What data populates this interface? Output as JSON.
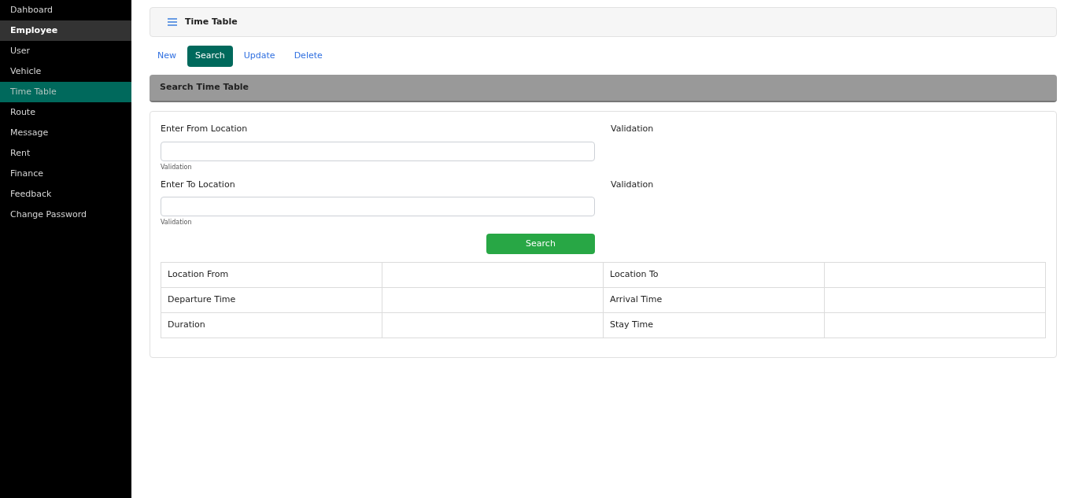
{
  "sidebar": {
    "items": [
      {
        "label": "Dahboard",
        "selected": false,
        "hovered": false
      },
      {
        "label": "Employee",
        "selected": false,
        "hovered": true
      },
      {
        "label": "User",
        "selected": false,
        "hovered": false
      },
      {
        "label": "Vehicle",
        "selected": false,
        "hovered": false
      },
      {
        "label": "Time Table",
        "selected": true,
        "hovered": false
      },
      {
        "label": "Route",
        "selected": false,
        "hovered": false
      },
      {
        "label": "Message",
        "selected": false,
        "hovered": false
      },
      {
        "label": "Rent",
        "selected": false,
        "hovered": false
      },
      {
        "label": "Finance",
        "selected": false,
        "hovered": false
      },
      {
        "label": "Feedback",
        "selected": false,
        "hovered": false
      },
      {
        "label": "Change Password",
        "selected": false,
        "hovered": false
      }
    ]
  },
  "header": {
    "title": "Time Table"
  },
  "tabs": [
    {
      "label": "New",
      "selected": false
    },
    {
      "label": "Search",
      "selected": true
    },
    {
      "label": "Update",
      "selected": false
    },
    {
      "label": "Delete",
      "selected": false
    }
  ],
  "section": {
    "title": "Search Time Table"
  },
  "form": {
    "fields": [
      {
        "label": "Enter From Location",
        "hint": "Validation",
        "validation": "Validation"
      },
      {
        "label": "Enter To Location",
        "hint": "Validation",
        "validation": "Validation"
      }
    ],
    "button": "Search"
  },
  "table": {
    "rows": [
      [
        "Location From",
        "",
        "Location To",
        ""
      ],
      [
        "Departure Time",
        "",
        "Arrival Time",
        ""
      ],
      [
        "Duration",
        "",
        "Stay Time",
        ""
      ]
    ]
  }
}
